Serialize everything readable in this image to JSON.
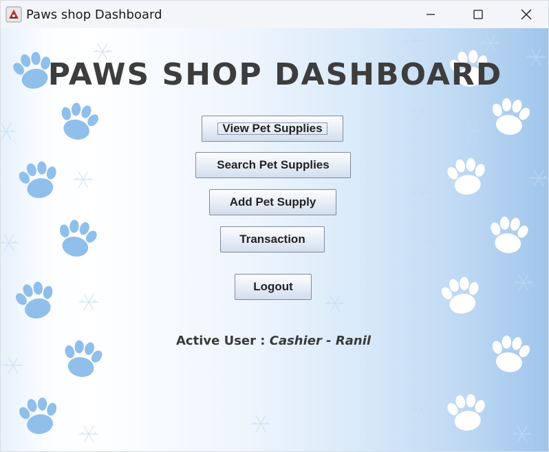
{
  "window": {
    "title": "Paws shop Dashboard",
    "icon": "java-app-icon",
    "controls": {
      "minimize": "minimize-icon",
      "maximize": "maximize-icon",
      "close": "close-icon"
    }
  },
  "dashboard": {
    "heading": "PAWS SHOP DASHBOARD",
    "buttons": {
      "view": "View Pet Supplies",
      "search": "Search Pet Supplies",
      "add": "Add Pet Supply",
      "transaction": "Transaction",
      "logout": "Logout"
    },
    "active_user": {
      "prefix": "Active User : ",
      "value": "Cashier - Ranil"
    }
  },
  "colors": {
    "paw_blue": "#8fbfea",
    "paw_white": "#ffffff",
    "heading": "#3d3d3d"
  }
}
